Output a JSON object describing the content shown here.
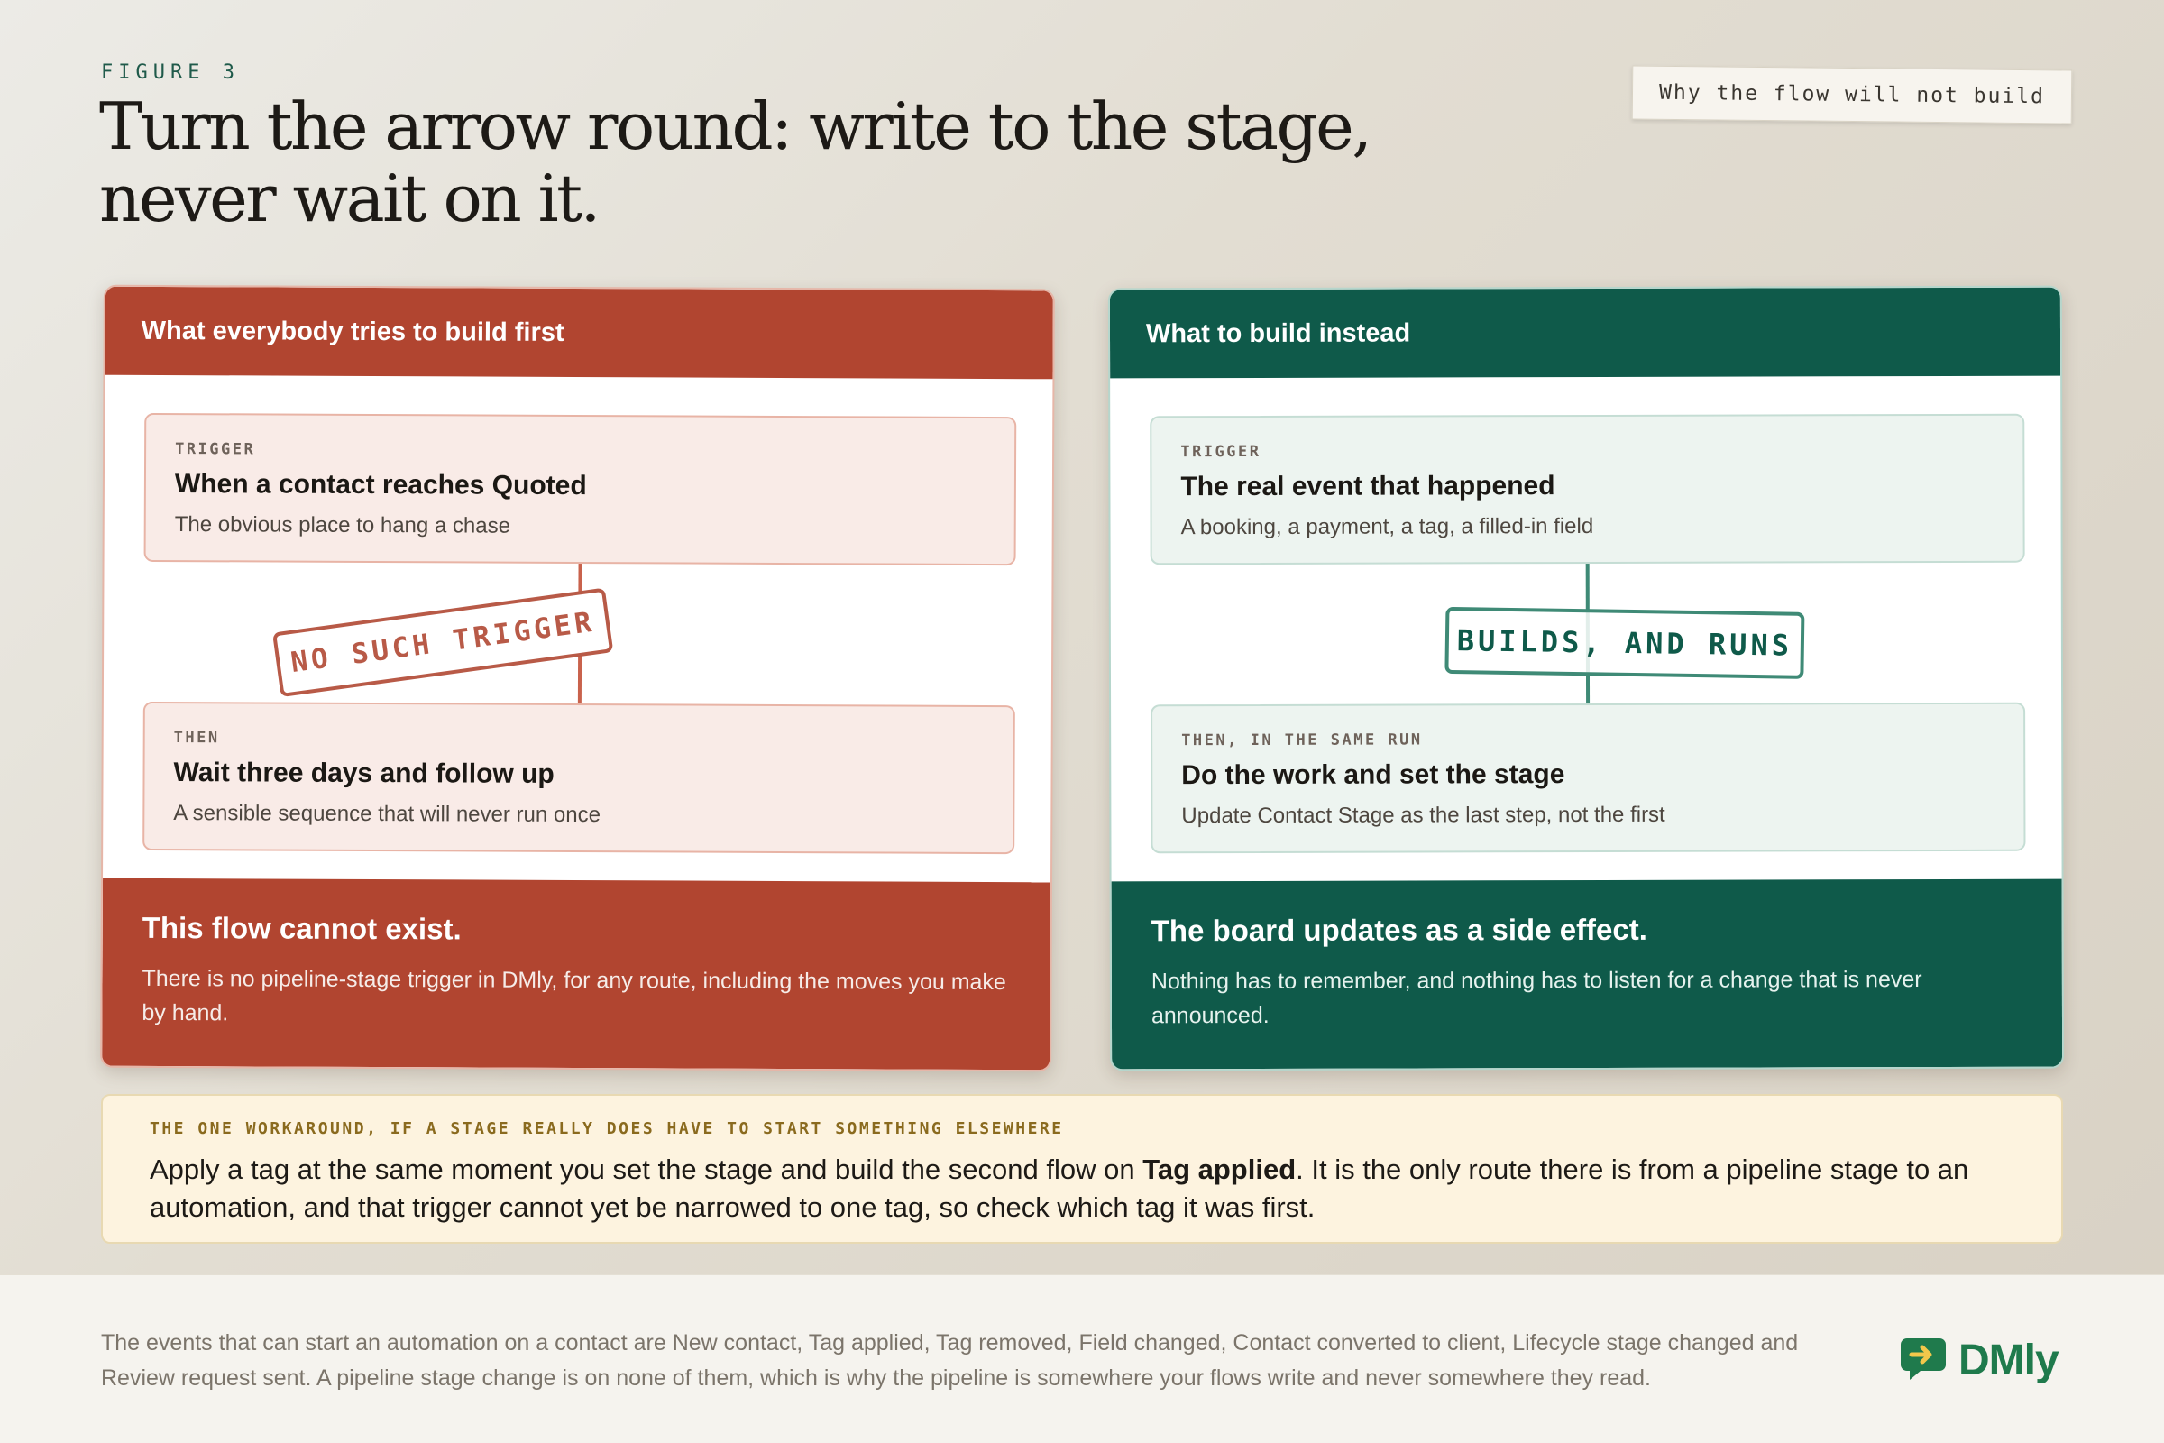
{
  "figure_label": "FIGURE 3",
  "title": "Turn the arrow round: write to the stage, never wait on it.",
  "corner_note": "Why the flow will not build",
  "left_panel": {
    "heading": "What everybody tries to build first",
    "top_card": {
      "kicker": "TRIGGER",
      "title": "When a contact reaches Quoted",
      "subtitle": "The obvious place to hang a chase"
    },
    "stamp": "NO SUCH TRIGGER",
    "bottom_card": {
      "kicker": "THEN",
      "title": "Wait three days and follow up",
      "subtitle": "A sensible sequence that will never run once"
    },
    "footer_title": "This flow cannot exist.",
    "footer_body": "There is no pipeline-stage trigger in DMly, for any route, including the moves you make by hand."
  },
  "right_panel": {
    "heading": "What to build instead",
    "top_card": {
      "kicker": "TRIGGER",
      "title": "The real event that happened",
      "subtitle": "A booking, a payment, a tag, a filled-in field"
    },
    "stamp": "BUILDS, AND RUNS",
    "bottom_card": {
      "kicker": "THEN, IN THE SAME RUN",
      "title": "Do the work and set the stage",
      "subtitle": "Update Contact Stage as the last step, not the first"
    },
    "footer_title": "The board updates as a side effect.",
    "footer_body": "Nothing has to remember, and nothing has to listen for a change that is never announced."
  },
  "workaround": {
    "kicker": "THE ONE WORKAROUND, IF A STAGE REALLY DOES HAVE TO START SOMETHING ELSEWHERE",
    "body_before": "Apply a tag at the same moment you set the stage and build the second flow on ",
    "body_bold": "Tag applied",
    "body_after": ". It is the only route there is from a pipeline stage to an automation, and that trigger cannot yet be narrowed to one tag, so check which tag it was first."
  },
  "footer": {
    "text": "The events that can start an automation on a contact are New contact, Tag applied, Tag removed, Field changed, Contact converted to client, Lifecycle stage changed and Review request sent. A pipeline stage change is on none of them, which is why the pipeline is somewhere your flows write and never somewhere they read.",
    "logo_word": "DMly",
    "logo_icon": "chat-arrow-icon"
  },
  "colors": {
    "warning": "#b14530",
    "success": "#0f5a4a",
    "note_bg": "#fdf3df",
    "brand": "#1f7a4c"
  }
}
